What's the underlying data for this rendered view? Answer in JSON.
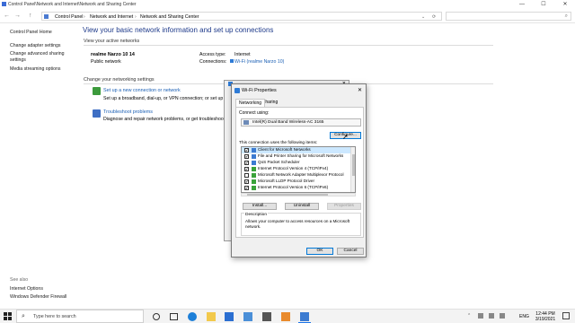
{
  "window": {
    "breadcrumb_path": "Control Panel\\Network and Internet\\Network and Sharing Center",
    "minimize": "—",
    "maximize": "☐",
    "close": "✕"
  },
  "addressbar": {
    "back": "←",
    "forward": "→",
    "up": "↑",
    "crumbs": [
      "Control Panel",
      "Network and Internet",
      "Network and Sharing Center"
    ],
    "refresh": "⟳",
    "search_placeholder": ""
  },
  "leftpane": {
    "home": "Control Panel Home",
    "links": [
      "Change adapter settings",
      "Change advanced sharing",
      "settings",
      "Media streaming options"
    ],
    "see_also_title": "See also",
    "see_also": [
      "Internet Options",
      "Windows Defender Firewall"
    ]
  },
  "main": {
    "title": "View your basic network information and set up connections",
    "active_networks": "View your active networks",
    "network_name": "realme Narzo 10 14",
    "network_type": "Public network",
    "access_type_label": "Access type:",
    "access_type_value": "Internet",
    "connections_label": "Connections:",
    "connections_value": "Wi-Fi (realme Narzo 10)",
    "change_settings": "Change your networking settings",
    "setup_link": "Set up a new connection or network",
    "setup_desc": "Set up a broadband, dial-up, or VPN connection; or set up a ro",
    "troubleshoot_link": "Troubleshoot problems",
    "troubleshoot_desc": "Diagnose and repair network problems, or get troubleshootir"
  },
  "backwindow": {
    "close": "✕"
  },
  "dialog": {
    "title": "Wi-Fi Properties",
    "close": "✕",
    "tabs": [
      "Networking",
      "Sharing"
    ],
    "connect_using": "Connect using:",
    "adapter": "Intel(R) Dual Band Wireless-AC 3165",
    "configure": "Configure...",
    "items_label": "This connection uses the following items:",
    "items": [
      {
        "label": "Client for Microsoft Networks",
        "checked": "✔"
      },
      {
        "label": "File and Printer Sharing for Microsoft Networks",
        "checked": "✔"
      },
      {
        "label": "QoS Packet Scheduler",
        "checked": "✔"
      },
      {
        "label": "Internet Protocol Version 4 (TCP/IPv4)",
        "checked": "✔"
      },
      {
        "label": "Microsoft Network Adapter Multiplexor Protocol",
        "checked": ""
      },
      {
        "label": "Microsoft LLDP Protocol Driver",
        "checked": "✔"
      },
      {
        "label": "Internet Protocol Version 6 (TCP/IPv6)",
        "checked": "✔"
      }
    ],
    "install": "Install...",
    "uninstall": "Uninstall",
    "properties": "Properties",
    "description_title": "Description",
    "description": "Allows your computer to access resources on a Microsoft network.",
    "ok": "OK",
    "cancel": "Cancel"
  },
  "taskbar": {
    "search_placeholder": "Type here to search",
    "language": "ENG",
    "time": "12:44 PM",
    "date": "3/19/2021"
  },
  "colors": {
    "link": "#1a5fb4",
    "title": "#1e3a8a",
    "selection": "#cce8ff"
  }
}
